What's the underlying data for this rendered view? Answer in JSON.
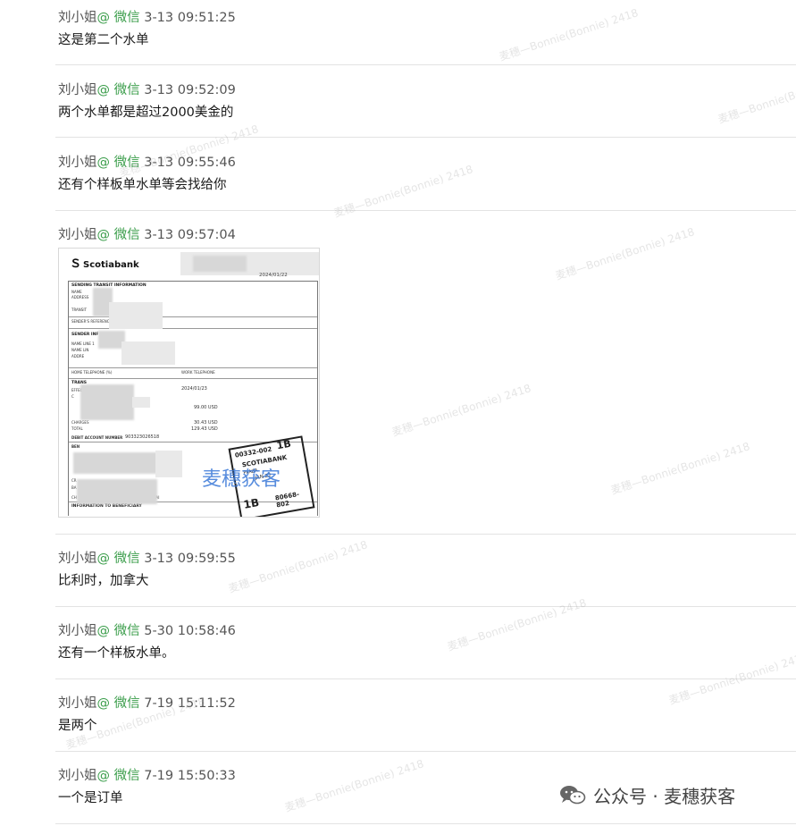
{
  "messages": [
    {
      "sender": "刘小姐",
      "source": "@ 微信",
      "time": "3-13 09:51:25",
      "text": "这是第二个水单"
    },
    {
      "sender": "刘小姐",
      "source": "@ 微信",
      "time": "3-13 09:52:09",
      "text": "两个水单都是超过2000美金的"
    },
    {
      "sender": "刘小姐",
      "source": "@ 微信",
      "time": "3-13 09:55:46",
      "text": "还有个样板单水单等会找给你"
    },
    {
      "sender": "刘小姐",
      "source": "@ 微信",
      "time": "3-13 09:57:04",
      "text": ""
    },
    {
      "sender": "刘小姐",
      "source": "@ 微信",
      "time": "3-13 09:59:55",
      "text": "比利时，加拿大"
    },
    {
      "sender": "刘小姐",
      "source": "@ 微信",
      "time": "5-30 10:58:46",
      "text": "还有一个样板水单。"
    },
    {
      "sender": "刘小姐",
      "source": "@ 微信",
      "time": "7-19 15:11:52",
      "text": "是两个"
    },
    {
      "sender": "刘小姐",
      "source": "@ 微信",
      "time": "7-19 15:50:33",
      "text": "一个是订单"
    }
  ],
  "receipt": {
    "bank": "Scotiabank",
    "date_top": "2024/01/22",
    "sec_sending": "SENDING TRANSIT INFORMATION",
    "lbl_name": "NAME",
    "lbl_address": "ADDRESS",
    "lbl_transit": "TRANSIT",
    "lbl_sender_ref": "SENDER'S REFERENCE",
    "sec_sender": "SENDER INF",
    "lbl_name_line1": "NAME LINE 1",
    "lbl_name_line2": "NAME LIN",
    "lbl_addr": "ADDRE",
    "lbl_home_tel": "HOME TELEPHONE (%)",
    "lbl_work_tel": "WORK TELEPHONE",
    "sec_trans": "TRANS",
    "lbl_effec": "EFFEC",
    "lbl_c": "C",
    "date_eff": "2024/01/23",
    "amount1": "99.00  USD",
    "lbl_charges": "CHARGES",
    "lbl_total": "TOTAL",
    "amount_charges": "30.43  USD",
    "amount_total": "129.43  USD",
    "lbl_debit": "DEBIT ACCOUNT NUMBER",
    "debit_number": "903323026518",
    "lbl_ben": "BEN",
    "lbl_cr": "CR",
    "lbl_ba": "BA",
    "sec_info": "INFORMATION TO BENEFICIARY",
    "lbl_ch": "CH",
    "lbl_are": "ARE PAI",
    "stamp_code": "00332-002",
    "stamp_1b": "1B",
    "stamp_bank": "SCOTIABANK",
    "stamp_plaza": "PLAZA",
    "stamp_date": "JAN 22",
    "stamp_1b_bottom": "1B",
    "stamp_code2": "80668-802",
    "image_watermark": "麦穗获客"
  },
  "watermark_text": "麦穗—Bonnie(Bonnie) 2418",
  "brand": {
    "label": "公众号 · 麦穗获客",
    "icon": "wechat-icon"
  },
  "colors": {
    "source_green": "#3a9d4a",
    "separator": "#e3e3e3",
    "image_watermark_blue": "#3a78d8"
  }
}
